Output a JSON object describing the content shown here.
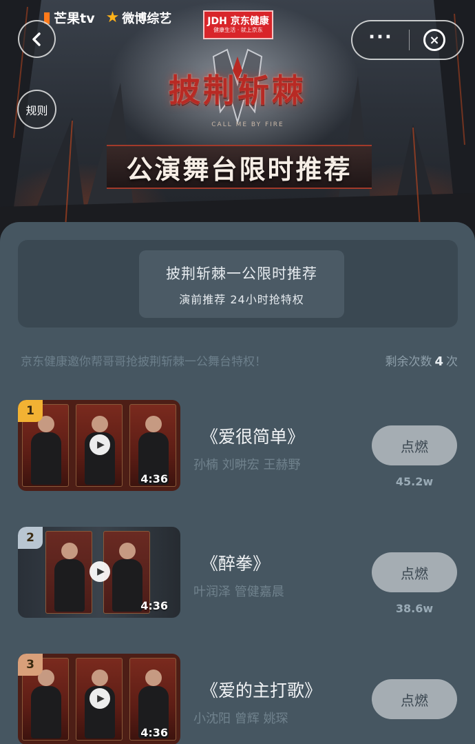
{
  "header": {
    "back_icon": "chevron-left-icon",
    "more_icon": "more-dots-icon",
    "close_icon": "close-circle-icon",
    "rules_label": "规则",
    "brands": {
      "mgtv": "芒果tv",
      "weibo": "微博综艺",
      "jd_main": "JDH 京东健康",
      "jd_sub": "健康生活 · 就上京东"
    },
    "show_title": "披荆斩棘",
    "show_subtitle": "CALL ME BY FIRE",
    "banner": "公演舞台限时推荐"
  },
  "info": {
    "title": "披荆斩棘一公限时推荐",
    "subtitle": "演前推荐 24小时抢特权"
  },
  "invite": {
    "text": "京东健康邀你帮哥哥抢披荆斩棘一公舞台特权！",
    "remain_prefix": "剩余次数",
    "remain_count": "4",
    "remain_suffix": "次"
  },
  "songs": [
    {
      "rank": "1",
      "rank_color": "#f2b233",
      "title": "《爱很简单》",
      "artists": "孙楠 刘畊宏 王赫野",
      "duration": "4:36",
      "button": "点燃",
      "heat": "45.2w"
    },
    {
      "rank": "2",
      "rank_color": "#b9c6d2",
      "title": "《醉拳》",
      "artists": "叶润泽 管健嘉晨",
      "duration": "4:36",
      "button": "点燃",
      "heat": "38.6w"
    },
    {
      "rank": "3",
      "rank_color": "#d9a07a",
      "title": "《爱的主打歌》",
      "artists": "小沈阳 曾辉 姚琛",
      "duration": "4:36",
      "button": "点燃",
      "heat": ""
    }
  ],
  "colors": {
    "panel": "#465661",
    "card": "#3a4852",
    "button": "#a5adb3",
    "accent_red": "#d8252a"
  }
}
